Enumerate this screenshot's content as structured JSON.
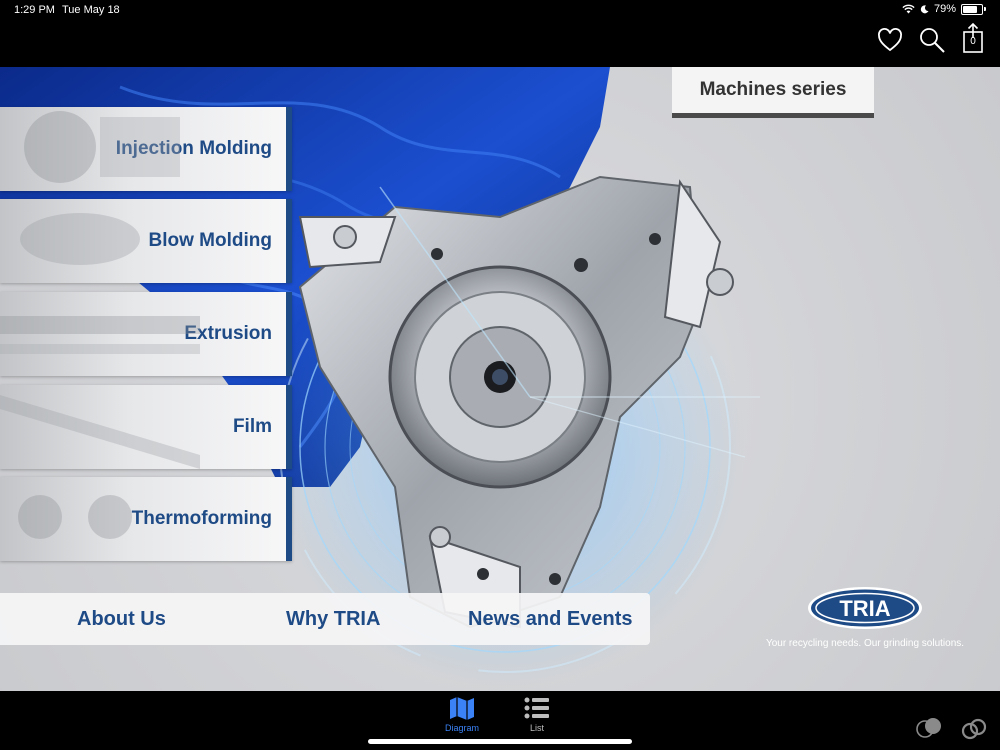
{
  "status_bar": {
    "time": "1:29 PM",
    "date": "Tue May 18",
    "battery": "79%"
  },
  "nav": {
    "cart_count": "0",
    "icons": [
      "heart-icon",
      "search-icon",
      "share-icon"
    ]
  },
  "series_button": {
    "label": "Machines series"
  },
  "categories": [
    {
      "label": "Injection Molding"
    },
    {
      "label": "Blow Molding"
    },
    {
      "label": "Extrusion"
    },
    {
      "label": "Film"
    },
    {
      "label": "Thermoforming"
    }
  ],
  "bottom_menu": {
    "about": "About Us",
    "why": "Why TRIA",
    "news": "News and Events"
  },
  "brand": {
    "name": "TRIA",
    "tagline": "Your recycling needs. Our grinding solutions.",
    "color": "#1e4a86"
  },
  "tabs": [
    {
      "label": "Diagram",
      "active": true
    },
    {
      "label": "List",
      "active": false
    }
  ],
  "colors": {
    "accent": "#1e4a86",
    "active_tab": "#3b82f6",
    "inactive_tab": "#bdbdbd"
  }
}
